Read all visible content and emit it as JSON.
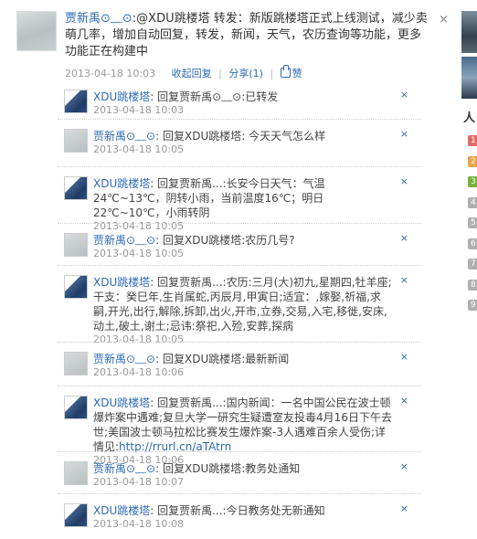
{
  "post": {
    "author": "贾新禹⊙﹏⊙",
    "text": ":@XDU跳楼塔 转发：新版跳楼塔正式上线测试，减少卖萌几率，增加自动回复，转发，新闻，天气，农历查询等功能，更多功能正在构建中",
    "time": "2013-04-18 10:03",
    "action_hide": "收起回复",
    "action_share": "分享(1)",
    "action_like": "赞",
    "close": "×"
  },
  "comments": [
    {
      "avatar": "blue",
      "author": "XDU跳楼塔",
      "text": ": 回复贾新禹⊙﹏⊙:已转发",
      "time": "2013-04-18 10:03"
    },
    {
      "avatar": "gray",
      "author": "贾新禹⊙﹏⊙",
      "text": ": 回复XDU跳楼塔: 今天天气怎么样",
      "time": "2013-04-18 10:05"
    },
    {
      "avatar": "blue",
      "author": "XDU跳楼塔",
      "text": ": 回复贾新禹...:长安今日天气：气温 24℃~13℃，阴转小雨，当前温度16℃；明日22℃~10℃，小雨转阴",
      "time": "2013-04-18 10:05"
    },
    {
      "avatar": "gray",
      "author": "贾新禹⊙﹏⊙",
      "text": ": 回复XDU跳楼塔:农历几号?",
      "time": "2013-04-18 10:05"
    },
    {
      "avatar": "blue",
      "author": "XDU跳楼塔",
      "text": ": 回复贾新禹...:农历:三月(大)初九,星期四,牡羊座;干支：癸巳年,生肖属蛇,丙辰月,甲寅日;适宜：,嫁娶,祈福,求嗣,开光,出行,解除,拆卸,出火,开市,立券,交易,入宅,移徙,安床,动土,破土,谢土;忌讳:祭祀,入殓,安葬,探病",
      "time": "2013-04-18 10:05"
    },
    {
      "avatar": "gray",
      "author": "贾新禹⊙﹏⊙",
      "text": ": 回复XDU跳楼塔:最新新闻",
      "time": "2013-04-18 10:06"
    },
    {
      "avatar": "blue",
      "author": "XDU跳楼塔",
      "text": ": 回复贾新禹...:国内新闻：一名中国公民在波士顿爆炸案中遇难;复旦大学一研究生疑遭室友投毒4月16日下午去世;美国波士顿马拉松比赛发生爆炸案-3人遇难百余人受伤;详情见:",
      "link": "http://rrurl.cn/aTAtrn",
      "time": "2013-04-18 10:06"
    },
    {
      "avatar": "gray",
      "author": "贾新禹⊙﹏⊙",
      "text": ": 回复XDU跳楼塔:教务处通知",
      "time": "2013-04-18 10:07"
    },
    {
      "avatar": "blue",
      "author": "XDU跳楼塔",
      "text": ": 回复贾新禹...:今日教务处无新通知",
      "time": "2013-04-18 10:08"
    }
  ],
  "comment_close": "×",
  "sidebar": {
    "title": "人",
    "ranks": [
      "1",
      "2",
      "3",
      "4",
      "5",
      "6",
      "7",
      "8",
      "9"
    ],
    "rank_colors": [
      "#e06b6b",
      "#e8a44a",
      "#7ab03c",
      "#b0b0b0",
      "#b0b0b0",
      "#b0b0b0",
      "#b0b0b0",
      "#b0b0b0",
      "#b0b0b0"
    ]
  }
}
